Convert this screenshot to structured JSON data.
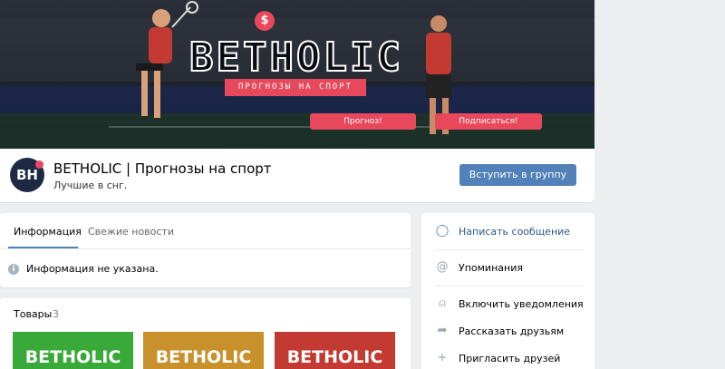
{
  "cover": {
    "brand": "BETHOLIC",
    "tagline": "ПРОГНОЗЫ НА СПОРТ",
    "forecast_button": "Прогноз!",
    "subscribe_button": "Подписаться!",
    "dollar_symbol": "$",
    "accent_color": "#e8485b"
  },
  "group": {
    "avatar_text": "BH",
    "name": "BETHOLIC | Прогнозы на спорт",
    "status": "Лучшие в снг.",
    "join_button": "Вступить в группу",
    "join_color": "#5181b8"
  },
  "info": {
    "tabs": [
      {
        "label": "Информация",
        "active": true
      },
      {
        "label": "Свежие новости",
        "active": false
      }
    ],
    "info_icon": "i",
    "message": "Информация не указана."
  },
  "goods": {
    "title": "Товары",
    "count": "3",
    "items": [
      {
        "label": "BETHOLIC",
        "color": "#39a93a"
      },
      {
        "label": "BETHOLIC",
        "color": "#c9912b"
      },
      {
        "label": "BETHOLIC",
        "color": "#c23a32"
      }
    ]
  },
  "sidebar": {
    "items": [
      {
        "icon": "message-bubble-icon",
        "glyph": "◯",
        "label": "Написать сообщение"
      },
      {
        "icon": "at-icon",
        "glyph": "@",
        "label": "Упоминания"
      },
      {
        "icon": "bell-icon",
        "glyph": "⍝",
        "label": "Включить уведомления"
      },
      {
        "icon": "share-icon",
        "glyph": "➦",
        "label": "Рассказать друзьям"
      },
      {
        "icon": "add-friend-icon",
        "glyph": "+",
        "label": "Пригласить друзей"
      }
    ]
  }
}
